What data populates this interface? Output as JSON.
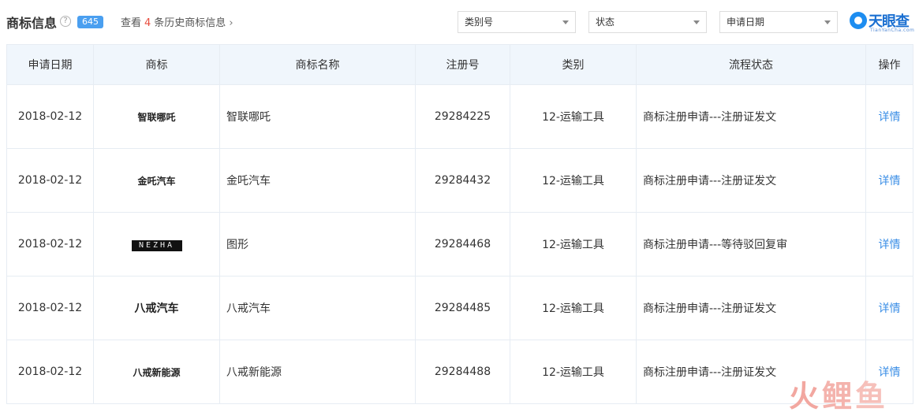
{
  "header": {
    "title": "商标信息",
    "help_glyph": "?",
    "count": "645",
    "history_prefix": "查看",
    "history_count": "4",
    "history_suffix": "条历史商标信息",
    "history_chevron": "›"
  },
  "filters": {
    "type_label": "类别号",
    "status_label": "状态",
    "date_label": "申请日期"
  },
  "logo": {
    "name": "天眼查",
    "sub": "TianYanCha.com"
  },
  "table": {
    "columns": [
      "申请日期",
      "商标",
      "商标名称",
      "注册号",
      "类别",
      "流程状态",
      "操作"
    ],
    "rows": [
      {
        "date": "2018-02-12",
        "mark": "智联哪吒",
        "name": "智联哪吒",
        "reg_no": "29284225",
        "category": "12-运输工具",
        "flow": "商标注册申请---注册证发文",
        "op": "详情"
      },
      {
        "date": "2018-02-12",
        "mark": "金吒汽车",
        "name": "金吒汽车",
        "reg_no": "29284432",
        "category": "12-运输工具",
        "flow": "商标注册申请---注册证发文",
        "op": "详情"
      },
      {
        "date": "2018-02-12",
        "mark": "NEZHA",
        "name": "图形",
        "reg_no": "29284468",
        "category": "12-运输工具",
        "flow": "商标注册申请---等待驳回复审",
        "op": "详情"
      },
      {
        "date": "2018-02-12",
        "mark": "八戒汽车",
        "name": "八戒汽车",
        "reg_no": "29284485",
        "category": "12-运输工具",
        "flow": "商标注册申请---注册证发文",
        "op": "详情"
      },
      {
        "date": "2018-02-12",
        "mark": "八戒新能源",
        "name": "八戒新能源",
        "reg_no": "29284488",
        "category": "12-运输工具",
        "flow": "商标注册申请---注册证发文",
        "op": "详情"
      }
    ]
  },
  "watermark": {
    "c1": "火",
    "c2": "鲤",
    "c3": "鱼"
  }
}
